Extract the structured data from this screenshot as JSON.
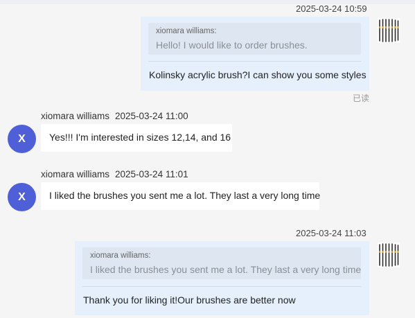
{
  "messages": [
    {
      "type": "outgoing",
      "timestamp": "2025-03-24 10:59",
      "quote_author": "xiomara williams:",
      "quote_text": "Hello! I would like to order brushes.",
      "text": "Kolinsky acrylic brush?I can show you some styles",
      "status": "已读"
    },
    {
      "type": "incoming",
      "sender": "xiomara williams",
      "timestamp": "2025-03-24 11:00",
      "avatar_letter": "X",
      "text": "Yes!!! I'm interested in sizes 12,14, and 16"
    },
    {
      "type": "incoming",
      "sender": "xiomara williams",
      "timestamp": "2025-03-24 11:01",
      "avatar_letter": "X",
      "text": "I liked the brushes you sent me a lot. They last a very long time"
    },
    {
      "type": "outgoing",
      "timestamp": "2025-03-24 11:03",
      "quote_author": "xiomara williams:",
      "quote_text": "I liked the brushes you sent me a lot. They last a very long time",
      "text": "Thank you for liking it!Our brushes are better now"
    }
  ],
  "colors": {
    "outgoing_bubble": "#e5f0fc",
    "quote_bg": "#dde6f1",
    "avatar": "#4e5fd8",
    "background": "#f5f5f5"
  },
  "icons": {
    "self_avatar": "brushes-avatar"
  }
}
